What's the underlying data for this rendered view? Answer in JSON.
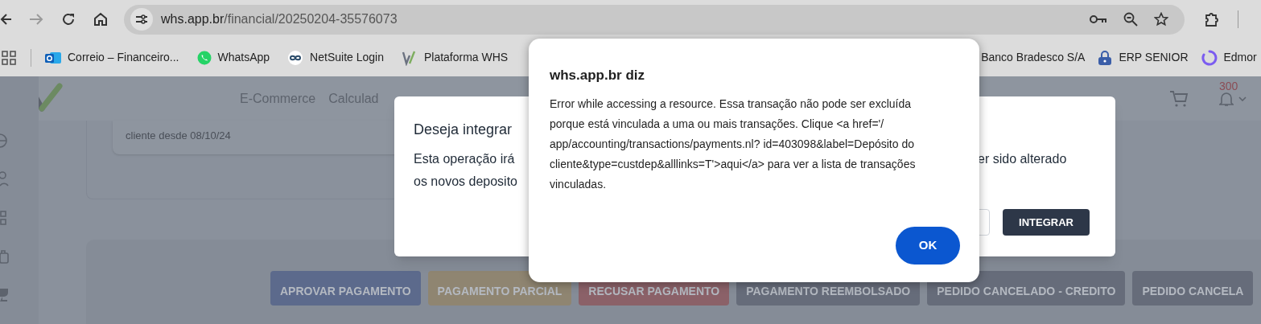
{
  "browser": {
    "url_host": "whs.app.br",
    "url_path": "/financial/20250204-35576073",
    "forward_disabled": true,
    "bookmarks": [
      {
        "label": "Correio – Financeiro...",
        "kind": "outlook"
      },
      {
        "label": "WhatsApp",
        "kind": "whatsapp"
      },
      {
        "label": "NetSuite Login",
        "kind": "netsuite"
      },
      {
        "label": "Plataforma WHS",
        "kind": "whs"
      },
      {
        "label": "Banco Bradesco S/A",
        "kind": "plain"
      },
      {
        "label": "ERP SENIOR",
        "kind": "lock"
      },
      {
        "label": "Edmor",
        "kind": "ring"
      }
    ]
  },
  "app": {
    "nav": [
      "E-Commerce",
      "Calculad"
    ],
    "notification_count": "300",
    "customer_since": "cliente desde 08/10/24",
    "actions": [
      {
        "label": "APROVAR PAGAMENTO",
        "color": "#5c6a8c"
      },
      {
        "label": "PAGAMENTO PARCIAL",
        "color": "#8f8571"
      },
      {
        "label": "RECUSAR PAGAMENTO",
        "color": "#8b6168"
      },
      {
        "label": "PAGAMENTO REEMBOLSADO",
        "color": "#666c7a"
      },
      {
        "label": "PEDIDO CANCELADO - CREDITO",
        "color": "#666c7a"
      },
      {
        "label": "PEDIDO CANCELA",
        "color": "#666c7a"
      }
    ]
  },
  "integrate_dialog": {
    "title": "Deseja integrar",
    "body_left": [
      "Esta operação irá",
      "os novos deposito"
    ],
    "body_right": "er sido alterado",
    "confirm_button": "INTEGRAR"
  },
  "alert": {
    "title": "whs.app.br diz",
    "message": "Error while accessing a resource. Essa transação não pode ser excluída porque está vinculada a uma ou mais transações. Clique <a href='/ app/accounting/transactions/payments.nl? id=403098&label=Depósito do cliente&type=custdep&alllinks=T'>aqui</a> para ver a lista de transações vinculadas.",
    "ok_button": "OK"
  }
}
